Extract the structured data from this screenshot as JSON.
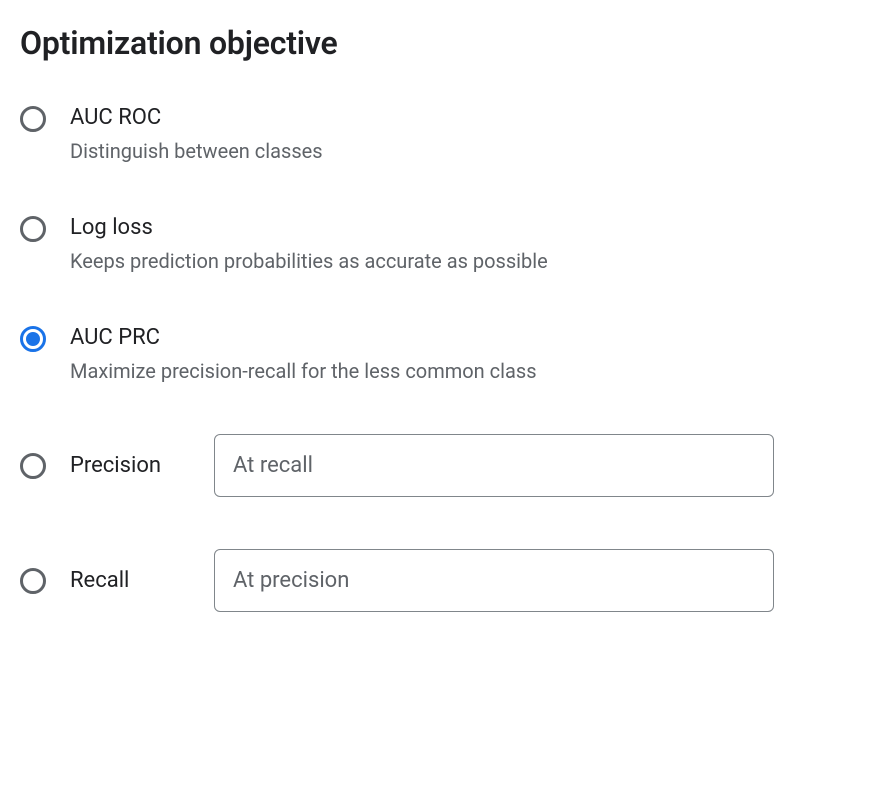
{
  "heading": "Optimization objective",
  "options": {
    "auc_roc": {
      "label": "AUC ROC",
      "desc": "Distinguish between classes",
      "selected": false
    },
    "log_loss": {
      "label": "Log loss",
      "desc": "Keeps prediction probabilities as accurate as possible",
      "selected": false
    },
    "auc_prc": {
      "label": "AUC PRC",
      "desc": "Maximize precision-recall for the less common class",
      "selected": true
    },
    "precision": {
      "label": "Precision",
      "input_placeholder": "At recall",
      "input_value": "",
      "selected": false
    },
    "recall": {
      "label": "Recall",
      "input_placeholder": "At precision",
      "input_value": "",
      "selected": false
    }
  }
}
